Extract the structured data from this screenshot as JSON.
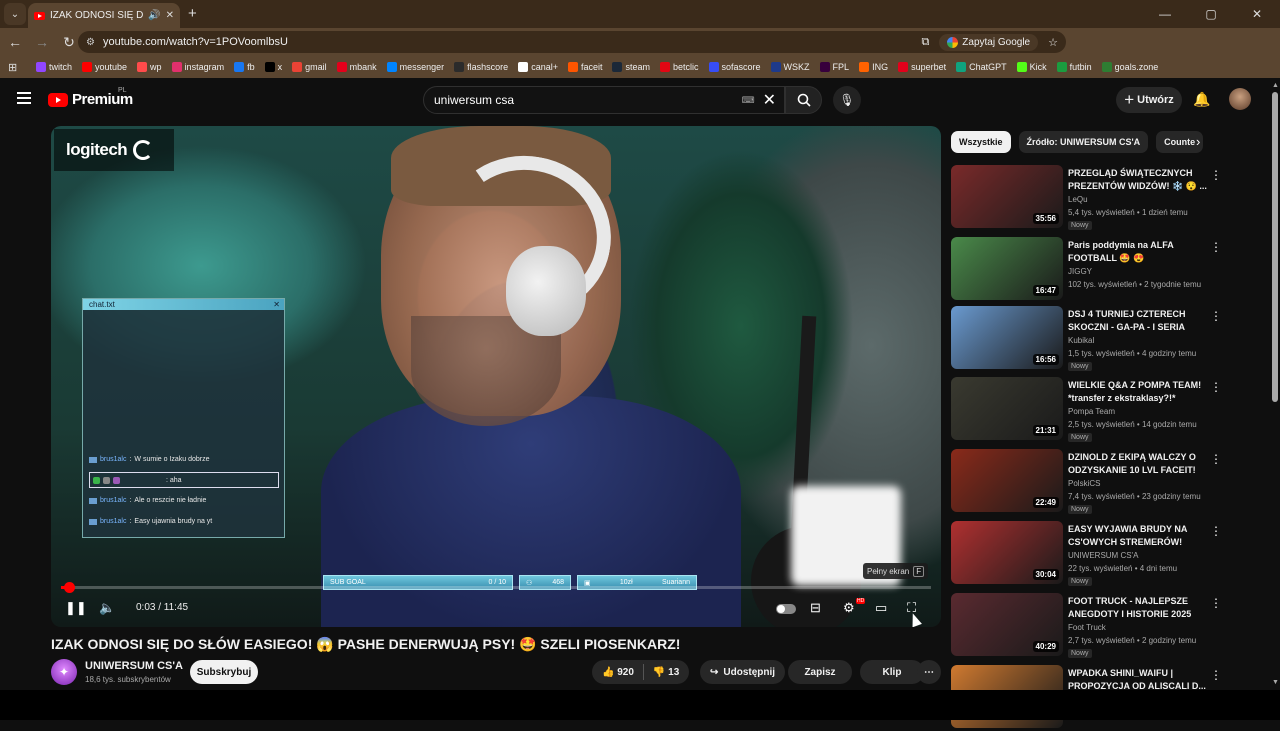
{
  "browser": {
    "tab_title": "IZAK ODNOSI SIĘ DO SŁÓW",
    "url": "youtube.com/watch?v=1POVoomlbsU",
    "ask_google": "Zapytaj Google",
    "bookmarks": [
      {
        "label": "twitch",
        "color": "#9146ff"
      },
      {
        "label": "youtube",
        "color": "#ff0000"
      },
      {
        "label": "wp",
        "color": "#ff4b4b"
      },
      {
        "label": "instagram",
        "color": "#e1306c"
      },
      {
        "label": "fb",
        "color": "#1877f2"
      },
      {
        "label": "x",
        "color": "#000000"
      },
      {
        "label": "gmail",
        "color": "#ea4335"
      },
      {
        "label": "mbank",
        "color": "#e3001b"
      },
      {
        "label": "messenger",
        "color": "#0084ff"
      },
      {
        "label": "flashscore",
        "color": "#2b2b2b"
      },
      {
        "label": "canal+",
        "color": "#ffffff"
      },
      {
        "label": "faceit",
        "color": "#ff5500"
      },
      {
        "label": "steam",
        "color": "#1b2838"
      },
      {
        "label": "betclic",
        "color": "#e30613"
      },
      {
        "label": "sofascore",
        "color": "#374df5"
      },
      {
        "label": "WSKZ",
        "color": "#1e3a8a"
      },
      {
        "label": "FPL",
        "color": "#37003c"
      },
      {
        "label": "ING",
        "color": "#ff6200"
      },
      {
        "label": "superbet",
        "color": "#e3001b"
      },
      {
        "label": "ChatGPT",
        "color": "#10a37f"
      },
      {
        "label": "Kick",
        "color": "#53fc18"
      },
      {
        "label": "futbin",
        "color": "#1b9c3f"
      },
      {
        "label": "goals.zone",
        "color": "#2e7d32"
      }
    ]
  },
  "header": {
    "brand": "Premium",
    "country": "PL",
    "search_value": "uniwersum csa",
    "create_label": "Utwórz"
  },
  "video": {
    "logo_text": "logitech",
    "chat_title": "chat.txt",
    "chat_messages": [
      {
        "user": "brus1alc",
        "text": "W sumie o Izaku dobrze"
      },
      {
        "user": "",
        "text": ": aha"
      },
      {
        "user": "brus1alc",
        "text": "Ale o reszcie nie ładnie"
      },
      {
        "user": "brus1alc",
        "text": "Easy ujawnia brudy na yt"
      }
    ],
    "overlay": {
      "sub_goal_label": "SUB GOAL",
      "sub_goal_value": "0 / 10",
      "viewers": "468",
      "level": "10zł",
      "donor": "Suariann"
    },
    "tooltip": "Pełny ekran",
    "tooltip_key": "F",
    "time": "0:03 / 11:45",
    "progress": 0.004,
    "hd_badge": "HD"
  },
  "info": {
    "title": "IZAK ODNOSI SIĘ DO SŁÓW EASIEGO! 😱 PASHE DENERWUJĄ PSY! 🤩 SZELI PIOSENKARZ!",
    "channel": "UNIWERSUM CS'A",
    "subs": "18,6 tys. subskrybentów",
    "subscribe": "Subskrybuj",
    "likes": "920",
    "dislikes": "13",
    "share": "Udostępnij",
    "save": "Zapisz",
    "clip": "Klip"
  },
  "sidebar": {
    "chips": [
      "Wszystkie",
      "Źródło: UNIWERSUM CS'A",
      "Counte"
    ],
    "recommendations": [
      {
        "title": "PRZEGLĄD ŚWIĄTECZNYCH PREZENTÓW WIDZÓW! ❄️ 😯 ...",
        "channel": "LeQu",
        "meta": "5,4 tys. wyświetleń • 1 dzień temu",
        "badge": "Nowy",
        "duration": "35:56",
        "bg": "#7a2a2a"
      },
      {
        "title": "Paris poddymia na ALFA FOOTBALL 🤩 😍",
        "channel": "JIGGY",
        "meta": "102 tys. wyświetleń • 2 tygodnie temu",
        "badge": "",
        "duration": "16:47",
        "bg": "#4a8a4a"
      },
      {
        "title": "DSJ 4 TURNIEJ CZTERECH SKOCZNI - GA-PA - I SERIA",
        "channel": "Kubikal",
        "meta": "1,5 tys. wyświetleń • 4 godziny temu",
        "badge": "Nowy",
        "duration": "16:56",
        "bg": "#6a9ad0"
      },
      {
        "title": "WIELKIE Q&A Z POMPA TEAM! *transfer z ekstraklasy?!*",
        "channel": "Pompa Team",
        "meta": "2,5 tys. wyświetleń • 14 godzin temu",
        "badge": "Nowy",
        "duration": "21:31",
        "bg": "#3a3a30"
      },
      {
        "title": "DZINOLD Z EKIPĄ WALCZY O ODZYSKANIE 10 LVL FACEIT!",
        "channel": "PolskiCS",
        "meta": "7,4 tys. wyświetleń • 23 godziny temu",
        "badge": "Nowy",
        "duration": "22:49",
        "bg": "#8a2a1a"
      },
      {
        "title": "EASY WYJAWIA BRUDY NA CS'OWYCH STREMERÓW!",
        "channel": "UNIWERSUM CS'A",
        "meta": "22 tys. wyświetleń • 4 dni temu",
        "badge": "Nowy",
        "duration": "30:04",
        "bg": "#b03030"
      },
      {
        "title": "FOOT TRUCK - NAJLEPSZE ANEGDOTY I HISTORIE 2025",
        "channel": "Foot Truck",
        "meta": "2,7 tys. wyświetleń • 2 godziny temu",
        "badge": "Nowy",
        "duration": "40:29",
        "bg": "#5a2a30"
      },
      {
        "title": "WPADKA SHINI_WAIFU | PROPOZYCJA OD ALISCALI D...",
        "channel": "",
        "meta": "",
        "badge": "",
        "duration": "",
        "bg": "#d07a30"
      }
    ]
  },
  "colors": {
    "accent": "#ff0000",
    "background": "#0f0f0f",
    "chrome": "#5a4530"
  }
}
